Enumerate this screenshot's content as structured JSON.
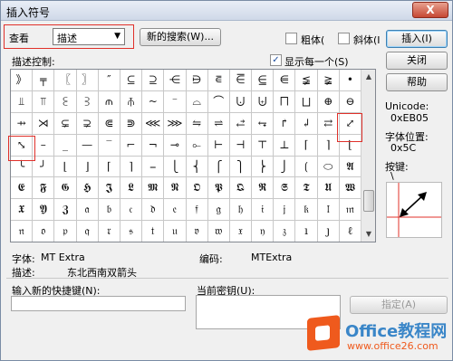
{
  "window": {
    "title": "插入符号",
    "close_label": "X"
  },
  "view": {
    "label": "查看",
    "selected": "描述"
  },
  "buttons": {
    "new_search": "新的搜索(W)...",
    "insert": "插入(I)",
    "close": "关闭",
    "help": "帮助",
    "assign": "指定(A)"
  },
  "checkboxes": {
    "bold": "粗体(",
    "italic": "斜体(I",
    "show_each": "显示每一个(S)",
    "bold_checked": false,
    "italic_checked": false,
    "show_each_checked": true
  },
  "grid_label": "描述控制:",
  "symbols": [
    "》",
    "╤",
    "〖",
    "〗",
    "″",
    "⊆",
    "⊇",
    "⋲",
    "⋻",
    "⋷",
    "⋶",
    "⋸",
    "⋹",
    "≨",
    "≩",
    "•",
    "⫫",
    "⫪",
    "⫕",
    "⫖",
    "⫙",
    "⫚",
    "~",
    "⁻",
    "⌓",
    "⌒",
    "⨃",
    "⨄",
    "⨅",
    "⨆",
    "⊕",
    "⊖",
    "⇸",
    "⋊",
    "⊊",
    "⊋",
    "⋐",
    "⋑",
    "⋘",
    "⋙",
    "⇋",
    "⇌",
    "⥄",
    "⥆",
    "↱",
    "↲",
    "⇄",
    "⤢",
    "⤡",
    "–",
    "_",
    "—",
    "‾",
    "⌐",
    "¬",
    "⊸",
    "⟜",
    "⊢",
    "⊣",
    "⊤",
    "⊥",
    "⌈",
    "⌉",
    "⌊",
    "╰",
    "╯",
    "⌊",
    "⌋",
    "⌈",
    "⌉",
    "⎯",
    "⎩",
    "⎨",
    "⎧",
    "⎫",
    "⎬",
    "⎭",
    "⟮",
    "⬭",
    "𝕬",
    "𝕰",
    "𝕱",
    "𝕲",
    "𝕳",
    "𝕵",
    "𝕷",
    "𝕸",
    "𝕹",
    "𝕺",
    "𝕻",
    "𝕼",
    "𝕽",
    "𝕾",
    "𝕿",
    "𝖀",
    "𝖂",
    "𝖃",
    "𝖄",
    "𝖅",
    "𝔞",
    "𝔟",
    "𝔠",
    "𝔡",
    "𝔢",
    "𝔣",
    "𝔤",
    "𝔥",
    "𝔦",
    "𝔧",
    "𝔨",
    "𝔩",
    "𝔪",
    "𝔫",
    "𝔬",
    "𝔭",
    "𝔮",
    "𝔯",
    "𝔰",
    "𝔱",
    "𝔲",
    "𝔳",
    "𝔴",
    "𝔵",
    "𝔶",
    "𝔷",
    "ı",
    "ȷ",
    "ℓ"
  ],
  "info": {
    "unicode_label": "Unicode:",
    "unicode_value": "0xEB05",
    "font_pos_label": "字体位置:",
    "font_pos_value": "0x5C",
    "key_label": "按键:",
    "key_value": "\\"
  },
  "details": {
    "font_label": "字体:",
    "font_value": "MT Extra",
    "code_label": "编码:",
    "code_value": "MTExtra",
    "desc_label": "描述:",
    "desc_value": "东北西南双箭头"
  },
  "shortcut": {
    "new_label": "输入新的快捷键(N):",
    "current_label": "当前密钥(U):"
  },
  "watermark": {
    "name": "Office教程网",
    "site": "www.office26.com"
  },
  "colors": {
    "highlight": "#e0302a",
    "window_border": "#7a8ca5",
    "accent": "#3c7fb1"
  }
}
